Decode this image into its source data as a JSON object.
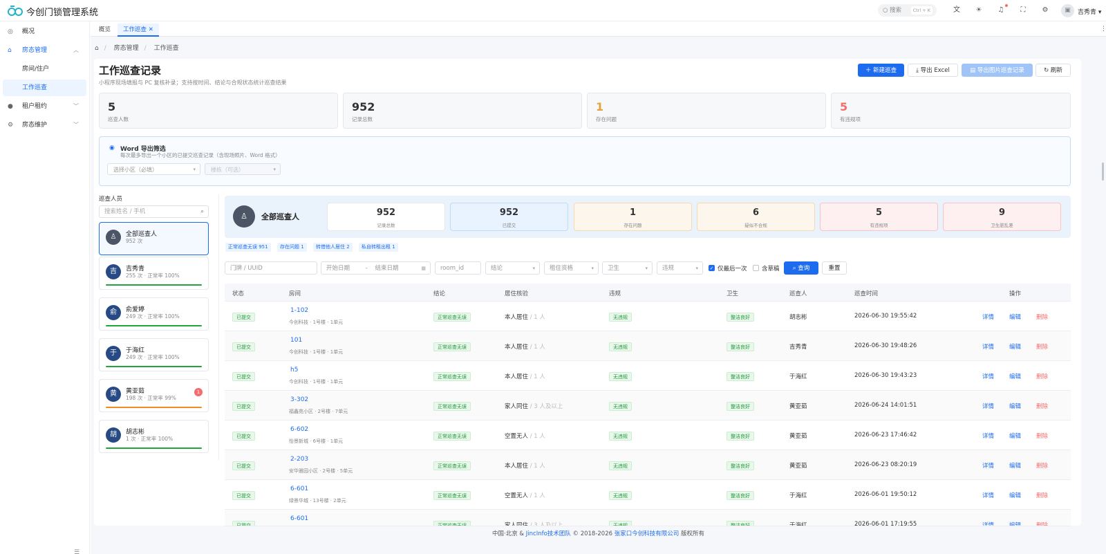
{
  "app": {
    "title": "今创门锁管理系统",
    "user": "吉秀青"
  },
  "topbar": {
    "search_placeholder": "搜索",
    "search_shortcut": "Ctrl + K"
  },
  "sidebar": {
    "items": [
      {
        "label": "概况",
        "icon": "dashboard-icon"
      },
      {
        "label": "房态管理",
        "icon": "home-icon"
      },
      {
        "label": "房间/住户",
        "icon": ""
      },
      {
        "label": "工作巡查",
        "icon": ""
      },
      {
        "label": "租户租约",
        "icon": "user-icon"
      },
      {
        "label": "房态维护",
        "icon": "gear-icon"
      }
    ]
  },
  "tabs": [
    {
      "label": "概览"
    },
    {
      "label": "工作巡查"
    }
  ],
  "breadcrumb": [
    "房态管理",
    "工作巡查"
  ],
  "page": {
    "title": "工作巡查记录",
    "subtitle": "小程序现场填报与 PC 复核补录；支持按时间、结论与合规状态统计巡查结果"
  },
  "actions": {
    "new": "新建巡查",
    "export_excel": "导出 Excel",
    "export_img": "导出图片巡查记录",
    "refresh": "刷新"
  },
  "stats": [
    {
      "value": "5",
      "label": "巡查人数",
      "color": "#333333"
    },
    {
      "value": "952",
      "label": "记录总数",
      "color": "#333333"
    },
    {
      "value": "1",
      "label": "存在问题",
      "color": "#e6a23c"
    },
    {
      "value": "5",
      "label": "有违规项",
      "color": "#f56c6c"
    }
  ],
  "word_export": {
    "title": "Word 导出筛选",
    "desc": "每次最多导出一个小区的已提交巡查记录（含现场照片、Word 格式）",
    "community_placeholder": "选择小区（必填）",
    "building_placeholder": "楼栋（可选）"
  },
  "people": {
    "title": "巡查人员",
    "search_placeholder": "搜索姓名 / 手机",
    "list": [
      {
        "avatar": "♙",
        "name": "全部巡查人",
        "count": "952 次",
        "badge": ""
      },
      {
        "avatar": "吉",
        "name": "吉秀青",
        "count": "255 次 · 正常率 100%",
        "badge": ""
      },
      {
        "avatar": "俞",
        "name": "俞爱婷",
        "count": "249 次 · 正常率 100%",
        "badge": ""
      },
      {
        "avatar": "于",
        "name": "于海红",
        "count": "249 次 · 正常率 100%",
        "badge": ""
      },
      {
        "avatar": "黄",
        "name": "黄亚茹",
        "count": "198 次 · 正常率 99%",
        "badge": "1"
      },
      {
        "avatar": "胡",
        "name": "胡志彬",
        "count": "1 次 · 正常率 100%",
        "badge": ""
      }
    ]
  },
  "summary": {
    "title": "全部巡查人",
    "boxes": [
      {
        "value": "952",
        "label": "记录总数"
      },
      {
        "value": "952",
        "label": "已提交"
      },
      {
        "value": "1",
        "label": "存在问题"
      },
      {
        "value": "6",
        "label": "疑似不合规"
      },
      {
        "value": "5",
        "label": "有违规项"
      },
      {
        "value": "9",
        "label": "卫生脏乱差"
      }
    ],
    "chips": [
      "正常巡查无误 951",
      "存在问题 1",
      "转借他人居住 2",
      "私自转租出租 1"
    ]
  },
  "filters": {
    "door": "门牌 / UUID",
    "start": "开始日期",
    "end": "结束日期",
    "room_id": "room_id",
    "conclusion": "结论",
    "qualification": "租住资格",
    "hygiene": "卫生",
    "violation": "违规",
    "only_last": "仅最后一次",
    "include_draft": "含草稿",
    "query": "查询",
    "reset": "重置"
  },
  "table": {
    "headers": [
      "状态",
      "房间",
      "结论",
      "居住核验",
      "违规",
      "卫生",
      "巡查人",
      "巡查时间",
      "操作"
    ],
    "rows": [
      {
        "status": "已提交",
        "room": "1-102",
        "addr": "今创科技 · 1号楼 · 1单元",
        "conclusion": "正常巡查无误",
        "live": "本人居住",
        "live_n": " / 1 人",
        "violation": "无违规",
        "hygiene": "整洁良好",
        "inspector": "胡志彬",
        "time": "2026-06-30 19:55:42"
      },
      {
        "status": "已提交",
        "room": "101",
        "addr": "今创科技 · 1号楼 · 1单元",
        "conclusion": "正常巡查无误",
        "live": "本人居住",
        "live_n": " / 1 人",
        "violation": "无违规",
        "hygiene": "整洁良好",
        "inspector": "吉秀青",
        "time": "2026-06-30 19:48:26"
      },
      {
        "status": "已提交",
        "room": "h5",
        "addr": "今创科技 · 1号楼 · 1单元",
        "conclusion": "正常巡查无误",
        "live": "本人居住",
        "live_n": " / 1 人",
        "violation": "无违规",
        "hygiene": "整洁良好",
        "inspector": "于海红",
        "time": "2026-06-30 19:43:23"
      },
      {
        "status": "已提交",
        "room": "3-302",
        "addr": "福鑫苑小区 · 2号楼 · 7单元",
        "conclusion": "正常巡查无误",
        "live": "家人同住",
        "live_n": " / 3 人及以上",
        "violation": "无违规",
        "hygiene": "整洁良好",
        "inspector": "黄亚茹",
        "time": "2026-06-24 14:01:51"
      },
      {
        "status": "已提交",
        "room": "6-602",
        "addr": "怡景新城 · 6号楼 · 1单元",
        "conclusion": "正常巡查无误",
        "live": "空置无人",
        "live_n": " / 1 人",
        "violation": "无违规",
        "hygiene": "整洁良好",
        "inspector": "黄亚茹",
        "time": "2026-06-23 17:46:42"
      },
      {
        "status": "已提交",
        "room": "2-203",
        "addr": "安华雅园小区 · 2号楼 · 5单元",
        "conclusion": "正常巡查无误",
        "live": "本人居住",
        "live_n": " / 1 人",
        "violation": "无违规",
        "hygiene": "整洁良好",
        "inspector": "黄亚茹",
        "time": "2026-06-23 08:20:19"
      },
      {
        "status": "已提交",
        "room": "6-601",
        "addr": "绿景华城 · 13号楼 · 2单元",
        "conclusion": "正常巡查无误",
        "live": "空置无人",
        "live_n": " / 1 人",
        "violation": "无违规",
        "hygiene": "整洁良好",
        "inspector": "于海红",
        "time": "2026-06-01 19:50:12"
      },
      {
        "status": "已提交",
        "room": "6-601",
        "addr": "",
        "conclusion": "正常巡查无误",
        "live": "家人同住",
        "live_n": " / 3 人及以上",
        "violation": "无违规",
        "hygiene": "整洁良好",
        "inspector": "于海红",
        "time": "2026-06-01 17:19:55"
      }
    ],
    "ops": {
      "detail": "详情",
      "edit": "编辑",
      "delete": "删除"
    }
  },
  "footer": {
    "prefix": "中国·北京 & ",
    "team": "JincInfo技术团队",
    "mid": " © 2018-2026 ",
    "company": "张家口今创科技有限公司",
    "suffix": " 版权所有"
  }
}
